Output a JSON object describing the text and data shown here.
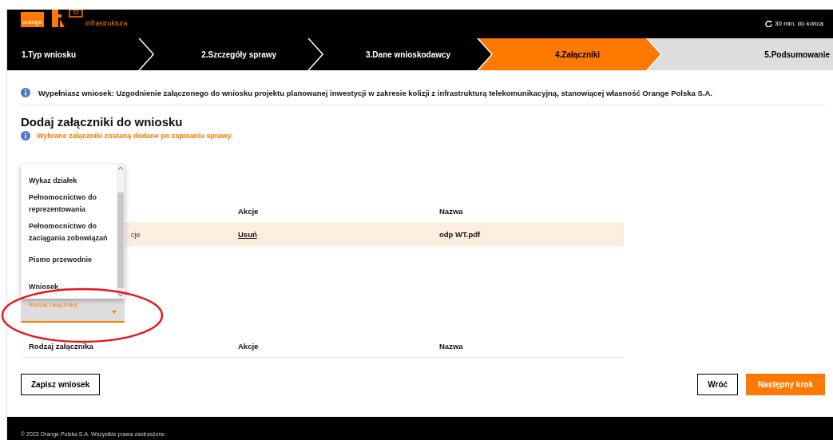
{
  "header": {
    "logo_text": "orange",
    "brand": "infrastruktura",
    "session_timer": "30 min. do końca"
  },
  "steps": [
    {
      "label": "1.Typ wniosku",
      "selected": false,
      "completed": true
    },
    {
      "label": "2.Szczegóły sprawy",
      "selected": false,
      "completed": true
    },
    {
      "label": "3.Dane wnioskodawcy",
      "selected": false,
      "completed": true
    },
    {
      "label": "4.Załączniki",
      "selected": true,
      "completed": false
    },
    {
      "label": "5.Podsumowanie",
      "selected": false,
      "completed": false
    }
  ],
  "info_banner": "Wypełniasz wniosek: Uzgodnienie załączonego do wniosku projektu planowanej inwestycji w zakresie kolizji z infrastrukturą telekomunikacyjną, stanowiącej własność Orange Polska S.A.",
  "section": {
    "title": "Dodaj załączniki do wniosku",
    "note": "Wybrane załączniki zostaną dodane po zapisaniu sprawy."
  },
  "attachment_type_dropdown": {
    "open": true,
    "options": [
      "Wykaz działek",
      "Pełnomocnictwo do reprezentowania",
      "Pełnomocnictwo do zaciągania zobowiązań",
      "Pismo przewodnie",
      "Wniosek"
    ]
  },
  "attachments_table": {
    "columns": [
      "Akcje",
      "Nazwa"
    ],
    "rows": [
      {
        "column_1": "cje",
        "action": "Usuń",
        "name": "odp WT.pdf"
      }
    ]
  },
  "attachment_type_select": {
    "label": "Rodzaj załącznika"
  },
  "new_attachments_table": {
    "columns": [
      "Rodzaj załącznika",
      "Akcje",
      "Nazwa"
    ]
  },
  "buttons": {
    "save": "Zapisz wniosek",
    "back": "Wróć",
    "next": "Następny krok"
  },
  "footer": "© 2023 Orange Polska S.A. Wszystkie prawa zastrzeżone."
}
